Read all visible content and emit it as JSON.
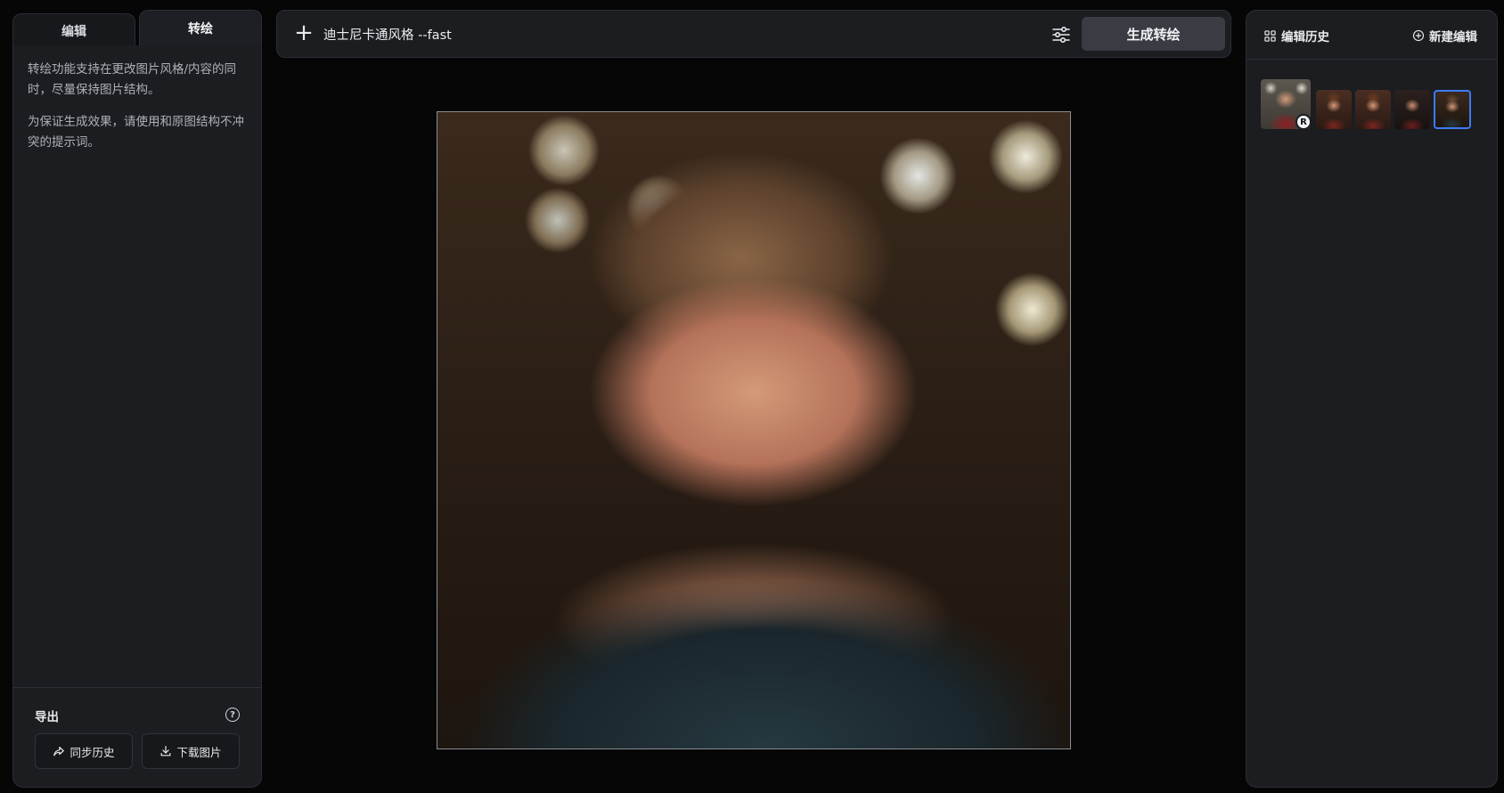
{
  "left_panel": {
    "tabs": [
      {
        "label": "编辑",
        "active": false
      },
      {
        "label": "转绘",
        "active": true
      }
    ],
    "description": [
      "转绘功能支持在更改图片风格/内容的同时，尽量保持图片结构。",
      "为保证生成效果，请使用和原图结构不冲突的提示词。"
    ],
    "export": {
      "title": "导出",
      "help_icon": "question-circle-icon",
      "help_glyph": "?",
      "buttons": [
        {
          "label": "同步历史",
          "icon": "share-icon"
        },
        {
          "label": "下载图片",
          "icon": "download-icon"
        }
      ]
    }
  },
  "topbar": {
    "add_icon": "plus-icon",
    "add_glyph": "+",
    "prompt": "迪士尼卡通风格 --fast",
    "settings_icon": "sliders-icon",
    "generate_label": "生成转绘"
  },
  "canvas": {
    "image": "cartoon-portrait-woman",
    "border_color": "#8a8d93"
  },
  "right_panel": {
    "history_title": "编辑历史",
    "history_icon": "grid-icon",
    "new_edit_label": "新建编辑",
    "new_edit_icon": "plus-circle-icon",
    "thumbnails": [
      {
        "kind": "original",
        "badge": "R"
      },
      {
        "kind": "result"
      },
      {
        "kind": "result"
      },
      {
        "kind": "result"
      },
      {
        "kind": "result",
        "selected": true
      }
    ],
    "selected_color": "#3d7bf4"
  }
}
